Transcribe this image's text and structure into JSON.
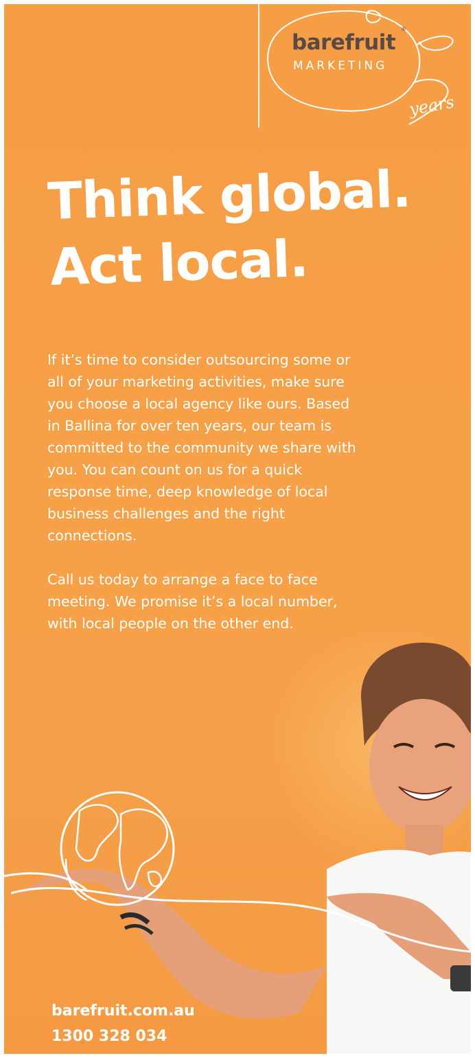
{
  "brand": {
    "name": "barefruit",
    "subline": "MARKETING",
    "registered_mark": "®",
    "years_label": "years"
  },
  "headline": {
    "line1": "Think global.",
    "line2": "Act local."
  },
  "body": {
    "paragraph1": "If it’s time to consider outsourcing some or all of your marketing activities, make sure you choose a local agency like ours. Based in Ballina for over ten years, our team is committed to the community we share with you. You can count on us for a quick response time, deep knowledge of local business challenges and the right connections.",
    "paragraph2": "Call us today to arrange a face to face meeting. We promise it’s a local number, with local people on the other end."
  },
  "contact": {
    "website": "barefruit.com.au",
    "phone": "1300 328 034"
  },
  "colors": {
    "background": "#f59e45",
    "text": "#ffffff",
    "logo_text": "#5a4a45"
  },
  "icons": {
    "globe": "globe-line-icon",
    "photo": "smiling-person-pointing-illustration"
  }
}
